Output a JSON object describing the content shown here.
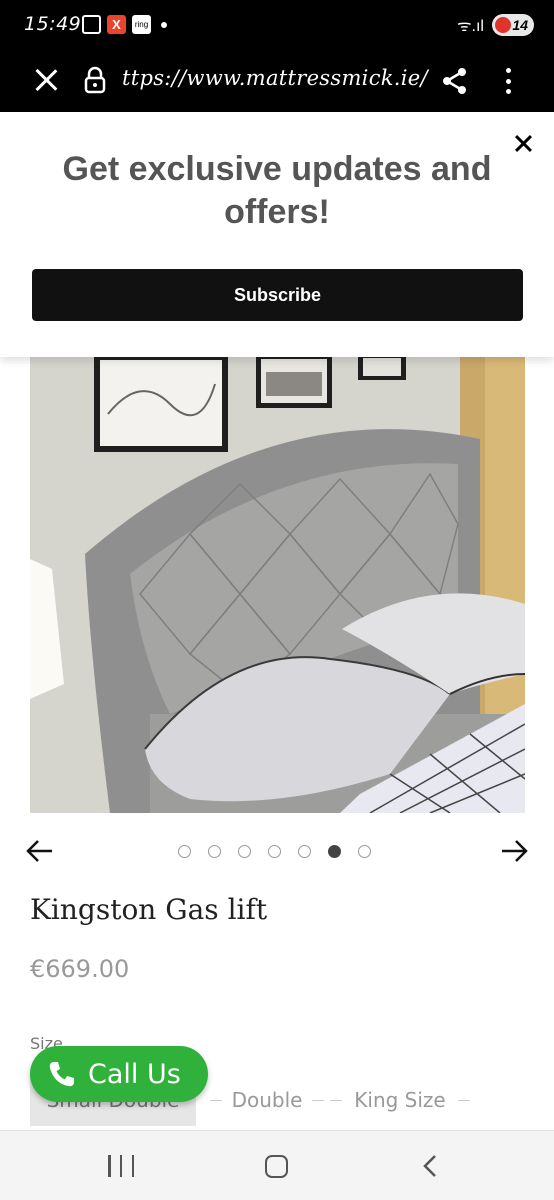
{
  "status_bar": {
    "time": "15:49",
    "notification_icons": [
      "screen-record-icon",
      "x-app-icon",
      "ring-app-icon"
    ],
    "ring_label": "ring",
    "x_label": "X",
    "wifi_label": "ᯤ.ıl",
    "battery_level": "14"
  },
  "browser": {
    "url": "ttps://www.mattressmick.ie/",
    "close_icon": "close-icon",
    "lock_icon": "lock-icon",
    "share_icon": "share-icon",
    "menu_icon": "more-vert-icon"
  },
  "popup": {
    "title": "Get exclusive updates and offers!",
    "subscribe_label": "Subscribe"
  },
  "product": {
    "title": "Kingston Gas lift",
    "price": "€669.00",
    "size_label": "Size",
    "sizes": [
      "Small Double",
      "Double",
      "King Size"
    ],
    "selected_size": "Small Double",
    "carousel": {
      "total": 7,
      "active_index": 5
    }
  },
  "call_us": {
    "label": "Call Us"
  },
  "colors": {
    "accent_green": "#2fb13b",
    "button_dark": "#111111",
    "headboard_grey": "#9b9b9b"
  }
}
